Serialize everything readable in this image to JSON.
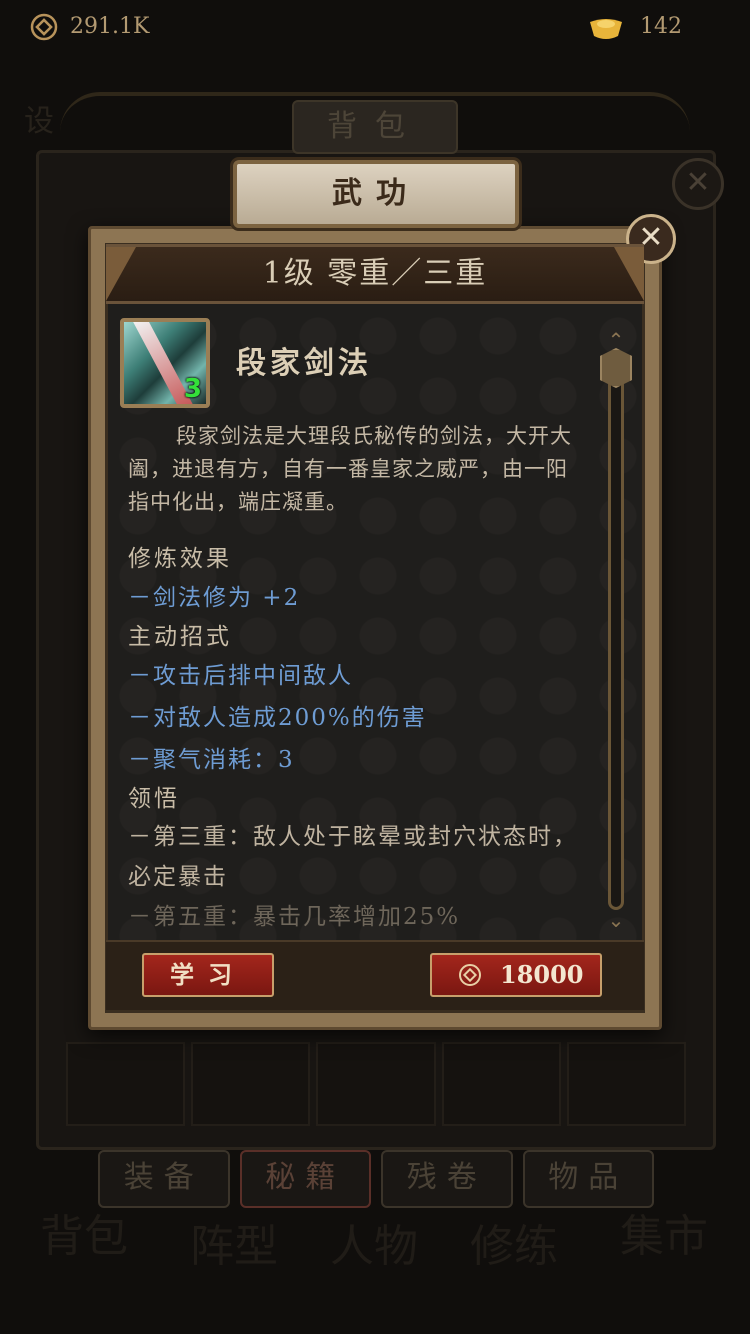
{
  "currency": {
    "coins": "291.1K",
    "ingots": "142"
  },
  "background": {
    "panel_title": "背包",
    "corner_text": "设",
    "tabs": [
      "装备",
      "秘籍",
      "残卷",
      "物品"
    ],
    "nav": [
      "背包",
      "阵型",
      "人物",
      "修练",
      "集市"
    ]
  },
  "popup": {
    "title": "武功",
    "level": "1级 零重／三重",
    "skill": {
      "name": "段家剑法",
      "count": "3"
    },
    "description": "段家剑法是大理段氏秘传的剑法，大开大阖，进退有方，自有一番皇家之威严，由一阳指中化出，端庄凝重。",
    "sections": {
      "training_title": "修炼效果",
      "training_effects": [
        "－剑法修为 +2"
      ],
      "active_title": "主动招式",
      "active_effects": [
        "－攻击后排中间敌人",
        "－对敌人造成200%的伤害",
        "－聚气消耗：3"
      ],
      "insight_title": "领悟",
      "insight_lines": [
        "－第三重：敌人处于眩晕或封穴状态时，必定暴击",
        "－第五重：暴击几率增加25%"
      ]
    },
    "learn_label": "学习",
    "cost": "18000",
    "close_glyph": "✕"
  },
  "colors": {
    "accent": "#a3261c",
    "effect_text": "#6e9cd3",
    "parchment": "#8d7553"
  }
}
